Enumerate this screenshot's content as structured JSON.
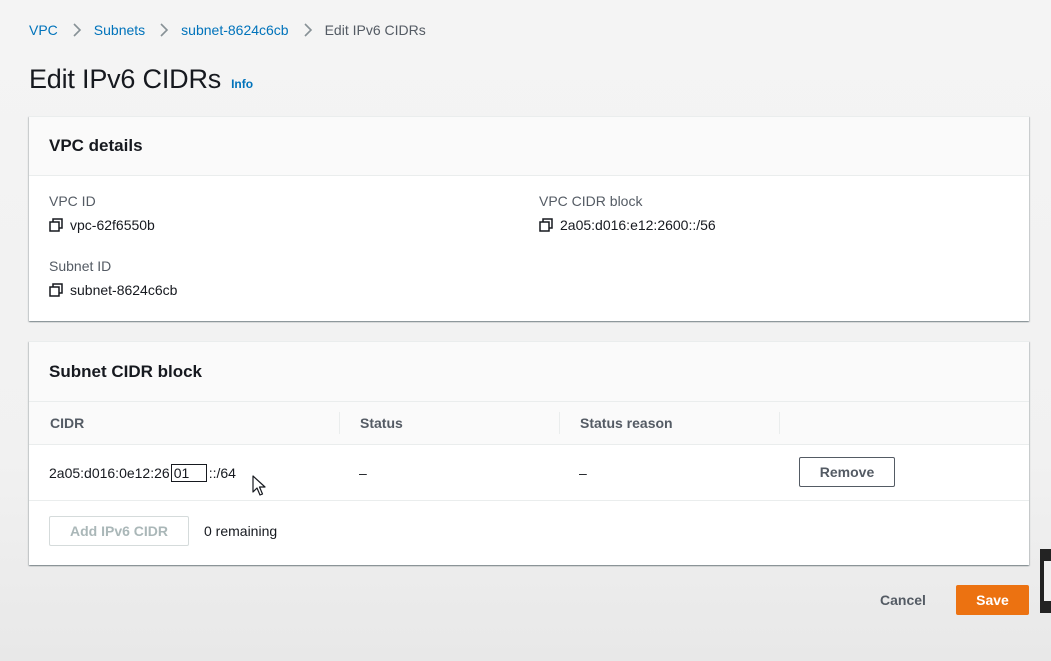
{
  "breadcrumb": {
    "items": [
      "VPC",
      "Subnets",
      "subnet-8624c6cb"
    ],
    "current": "Edit IPv6 CIDRs"
  },
  "page": {
    "title": "Edit IPv6 CIDRs",
    "info_link": "Info"
  },
  "vpc_details": {
    "heading": "VPC details",
    "vpc_id_label": "VPC ID",
    "vpc_id_value": "vpc-62f6550b",
    "vpc_cidr_label": "VPC CIDR block",
    "vpc_cidr_value": "2a05:d016:e12:2600::/56",
    "subnet_id_label": "Subnet ID",
    "subnet_id_value": "subnet-8624c6cb"
  },
  "subnet_cidr": {
    "heading": "Subnet CIDR block",
    "columns": [
      "CIDR",
      "Status",
      "Status reason"
    ],
    "row": {
      "cidr_prefix": "2a05:d016:0e12:26",
      "cidr_input_value": "01",
      "cidr_suffix": "::/64",
      "status": "–",
      "status_reason": "–",
      "remove_label": "Remove"
    },
    "add_label": "Add IPv6 CIDR",
    "remaining_text": "0 remaining"
  },
  "footer": {
    "cancel_label": "Cancel",
    "save_label": "Save"
  },
  "colors": {
    "link": "#0073bb",
    "primary": "#ec7211",
    "text": "#16191f",
    "muted": "#545b64"
  }
}
